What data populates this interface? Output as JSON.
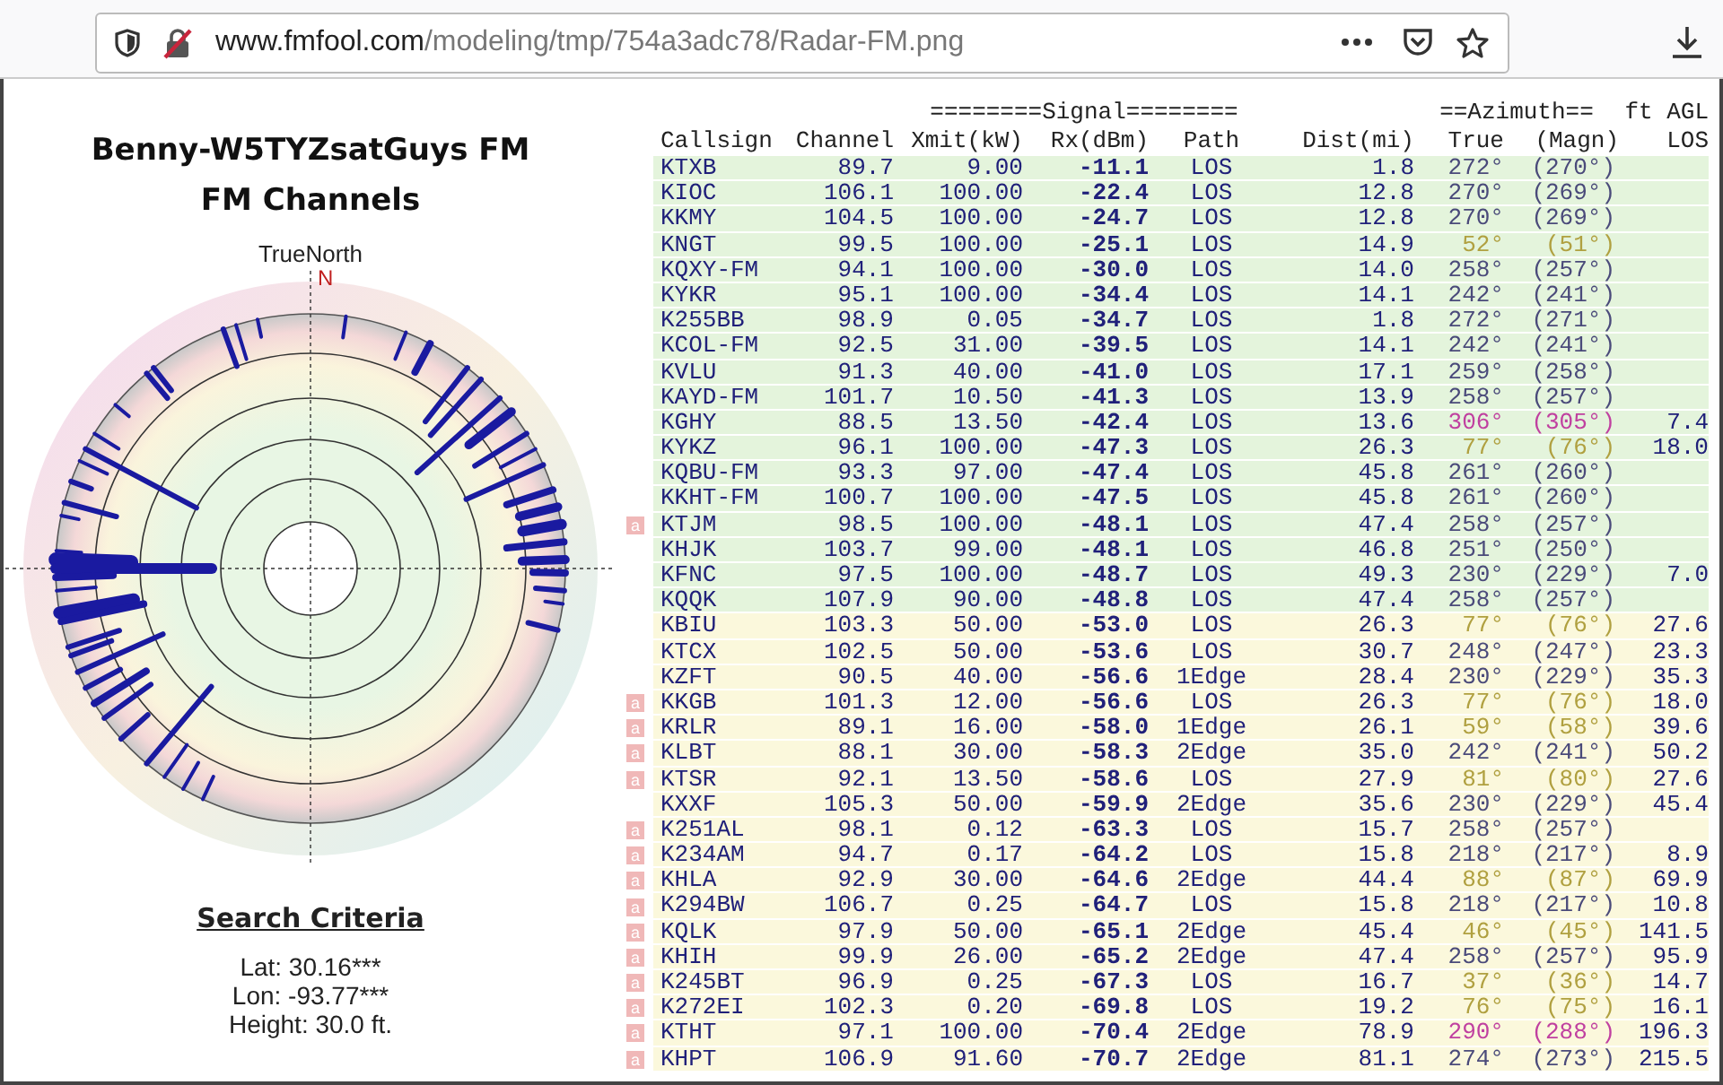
{
  "browser": {
    "url_host": "www.fmfool.com",
    "url_path": "/modeling/tmp/754a3adc78/Radar-FM.png"
  },
  "report": {
    "title_lines": [
      "Benny-W5TYZsatGuys FM",
      "FM Channels"
    ],
    "north_label": "TrueNorth",
    "north_letter": "N",
    "criteria_title": "Search Criteria",
    "criteria": [
      "Lat: 30.16***",
      "Lon: -93.77***",
      "Height: 30.0 ft."
    ]
  },
  "table": {
    "groups": [
      {
        "label": "========Signal========",
        "kind": "signal"
      },
      {
        "label": "==Azimuth==",
        "kind": "azimuth"
      },
      {
        "label": "ft AGL",
        "kind": "los"
      }
    ],
    "columns": [
      "Callsign",
      "Channel",
      "Xmit(kW)",
      "Rx(dBm)",
      "Path",
      "Dist(mi)",
      "True",
      "(Magn)",
      "LOS"
    ],
    "rows": [
      {
        "cells": [
          "KTXB",
          "89.7",
          "9.00",
          "-11.1",
          "LOS",
          "1.8",
          "272°",
          "(270°)",
          ""
        ],
        "kind": "strong",
        "color": "#4a4a7a"
      },
      {
        "cells": [
          "KIOC",
          "106.1",
          "100.00",
          "-22.4",
          "LOS",
          "12.8",
          "270°",
          "(269°)",
          ""
        ],
        "kind": "strong",
        "color": "#4a4a7a"
      },
      {
        "cells": [
          "KKMY",
          "104.5",
          "100.00",
          "-24.7",
          "LOS",
          "12.8",
          "270°",
          "(269°)",
          ""
        ],
        "kind": "strong",
        "color": "#4a4a7a"
      },
      {
        "cells": [
          "KNGT",
          "99.5",
          "100.00",
          "-25.1",
          "LOS",
          "14.9",
          "52°",
          "(51°)",
          ""
        ],
        "kind": "strong",
        "color": "#b0a040"
      },
      {
        "cells": [
          "KQXY-FM",
          "94.1",
          "100.00",
          "-30.0",
          "LOS",
          "14.0",
          "258°",
          "(257°)",
          ""
        ],
        "kind": "strong",
        "color": "#4a4a7a"
      },
      {
        "cells": [
          "KYKR",
          "95.1",
          "100.00",
          "-34.4",
          "LOS",
          "14.1",
          "242°",
          "(241°)",
          ""
        ],
        "kind": "strong",
        "color": "#4a4a7a"
      },
      {
        "cells": [
          "K255BB",
          "98.9",
          "0.05",
          "-34.7",
          "LOS",
          "1.8",
          "272°",
          "(271°)",
          ""
        ],
        "kind": "strong",
        "color": "#4a4a7a"
      },
      {
        "cells": [
          "KCOL-FM",
          "92.5",
          "31.00",
          "-39.5",
          "LOS",
          "14.1",
          "242°",
          "(241°)",
          ""
        ],
        "kind": "strong",
        "color": "#4a4a7a"
      },
      {
        "cells": [
          "KVLU",
          "91.3",
          "40.00",
          "-41.0",
          "LOS",
          "17.1",
          "259°",
          "(258°)",
          ""
        ],
        "kind": "strong",
        "color": "#4a4a7a"
      },
      {
        "cells": [
          "KAYD-FM",
          "101.7",
          "10.50",
          "-41.3",
          "LOS",
          "13.9",
          "258°",
          "(257°)",
          ""
        ],
        "kind": "strong",
        "color": "#4a4a7a"
      },
      {
        "cells": [
          "KGHY",
          "88.5",
          "13.50",
          "-42.4",
          "LOS",
          "13.6",
          "306°",
          "(305°)",
          "7.4"
        ],
        "kind": "strong",
        "color": "#c040a0"
      },
      {
        "cells": [
          "KYKZ",
          "96.1",
          "100.00",
          "-47.3",
          "LOS",
          "26.3",
          "77°",
          "(76°)",
          "18.0"
        ],
        "kind": "strong",
        "color": "#b0a040"
      },
      {
        "cells": [
          "KQBU-FM",
          "93.3",
          "97.00",
          "-47.4",
          "LOS",
          "45.8",
          "261°",
          "(260°)",
          ""
        ],
        "kind": "strong",
        "color": "#4a4a7a"
      },
      {
        "cells": [
          "KKHT-FM",
          "100.7",
          "100.00",
          "-47.5",
          "LOS",
          "45.8",
          "261°",
          "(260°)",
          ""
        ],
        "kind": "strong",
        "color": "#4a4a7a"
      },
      {
        "cells": [
          "KTJM",
          "98.5",
          "100.00",
          "-48.1",
          "LOS",
          "47.4",
          "258°",
          "(257°)",
          ""
        ],
        "kind": "strong",
        "color": "#4a4a7a",
        "note": "a"
      },
      {
        "cells": [
          "KHJK",
          "103.7",
          "99.00",
          "-48.1",
          "LOS",
          "46.8",
          "251°",
          "(250°)",
          ""
        ],
        "kind": "strong",
        "color": "#4a4a7a"
      },
      {
        "cells": [
          "KFNC",
          "97.5",
          "100.00",
          "-48.7",
          "LOS",
          "49.3",
          "230°",
          "(229°)",
          "7.0"
        ],
        "kind": "strong",
        "color": "#4a4a7a"
      },
      {
        "cells": [
          "KQQK",
          "107.9",
          "90.00",
          "-48.8",
          "LOS",
          "47.4",
          "258°",
          "(257°)",
          ""
        ],
        "kind": "strong",
        "color": "#4a4a7a"
      },
      {
        "cells": [
          "KBIU",
          "103.3",
          "50.00",
          "-53.0",
          "LOS",
          "26.3",
          "77°",
          "(76°)",
          "27.6"
        ],
        "kind": "weak",
        "color": "#b0a040"
      },
      {
        "cells": [
          "KTCX",
          "102.5",
          "50.00",
          "-53.6",
          "LOS",
          "30.7",
          "248°",
          "(247°)",
          "23.3"
        ],
        "kind": "weak",
        "color": "#4a4a7a"
      },
      {
        "cells": [
          "KZFT",
          "90.5",
          "40.00",
          "-56.6",
          "1Edge",
          "28.4",
          "230°",
          "(229°)",
          "35.3"
        ],
        "kind": "weak",
        "color": "#4a4a7a"
      },
      {
        "cells": [
          "KKGB",
          "101.3",
          "12.00",
          "-56.6",
          "LOS",
          "26.3",
          "77°",
          "(76°)",
          "18.0"
        ],
        "kind": "weak",
        "color": "#b0a040",
        "note": "a"
      },
      {
        "cells": [
          "KRLR",
          "89.1",
          "16.00",
          "-58.0",
          "1Edge",
          "26.1",
          "59°",
          "(58°)",
          "39.6"
        ],
        "kind": "weak",
        "color": "#b0a040",
        "note": "a"
      },
      {
        "cells": [
          "KLBT",
          "88.1",
          "30.00",
          "-58.3",
          "2Edge",
          "35.0",
          "242°",
          "(241°)",
          "50.2"
        ],
        "kind": "weak",
        "color": "#4a4a7a",
        "note": "a"
      },
      {
        "cells": [
          "KTSR",
          "92.1",
          "13.50",
          "-58.6",
          "LOS",
          "27.9",
          "81°",
          "(80°)",
          "27.6"
        ],
        "kind": "weak",
        "color": "#b0a040",
        "note": "a"
      },
      {
        "cells": [
          "KXXF",
          "105.3",
          "50.00",
          "-59.9",
          "2Edge",
          "35.6",
          "230°",
          "(229°)",
          "45.4"
        ],
        "kind": "weak",
        "color": "#4a4a7a"
      },
      {
        "cells": [
          "K251AL",
          "98.1",
          "0.12",
          "-63.3",
          "LOS",
          "15.7",
          "258°",
          "(257°)",
          ""
        ],
        "kind": "weak",
        "color": "#4a4a7a",
        "note": "a"
      },
      {
        "cells": [
          "K234AM",
          "94.7",
          "0.17",
          "-64.2",
          "LOS",
          "15.8",
          "218°",
          "(217°)",
          "8.9"
        ],
        "kind": "weak",
        "color": "#4a4a7a",
        "note": "a"
      },
      {
        "cells": [
          "KHLA",
          "92.9",
          "30.00",
          "-64.6",
          "2Edge",
          "44.4",
          "88°",
          "(87°)",
          "69.9"
        ],
        "kind": "weak",
        "color": "#b0a040",
        "note": "a"
      },
      {
        "cells": [
          "K294BW",
          "106.7",
          "0.25",
          "-64.7",
          "LOS",
          "15.8",
          "218°",
          "(217°)",
          "10.8"
        ],
        "kind": "weak",
        "color": "#4a4a7a",
        "note": "a"
      },
      {
        "cells": [
          "KQLK",
          "97.9",
          "50.00",
          "-65.1",
          "2Edge",
          "45.4",
          "46°",
          "(45°)",
          "141.5"
        ],
        "kind": "weak",
        "color": "#b0a040",
        "note": "a"
      },
      {
        "cells": [
          "KHIH",
          "99.9",
          "26.00",
          "-65.2",
          "2Edge",
          "47.4",
          "258°",
          "(257°)",
          "95.9"
        ],
        "kind": "weak",
        "color": "#4a4a7a",
        "note": "a"
      },
      {
        "cells": [
          "K245BT",
          "96.9",
          "0.25",
          "-67.3",
          "LOS",
          "16.7",
          "37°",
          "(36°)",
          "14.7"
        ],
        "kind": "weak",
        "color": "#b0a040",
        "note": "a"
      },
      {
        "cells": [
          "K272EI",
          "102.3",
          "0.20",
          "-69.8",
          "LOS",
          "19.2",
          "76°",
          "(75°)",
          "16.1"
        ],
        "kind": "weak",
        "color": "#b0a040",
        "note": "a"
      },
      {
        "cells": [
          "KTHT",
          "97.1",
          "100.00",
          "-70.4",
          "2Edge",
          "78.9",
          "290°",
          "(288°)",
          "196.3"
        ],
        "kind": "weak",
        "color": "#c040a0",
        "note": "a"
      },
      {
        "cells": [
          "KHPT",
          "106.9",
          "91.60",
          "-70.7",
          "2Edge",
          "81.1",
          "274°",
          "(273°)",
          "215.5"
        ],
        "kind": "weak",
        "color": "#4a4a7a",
        "note": "a"
      }
    ]
  }
}
